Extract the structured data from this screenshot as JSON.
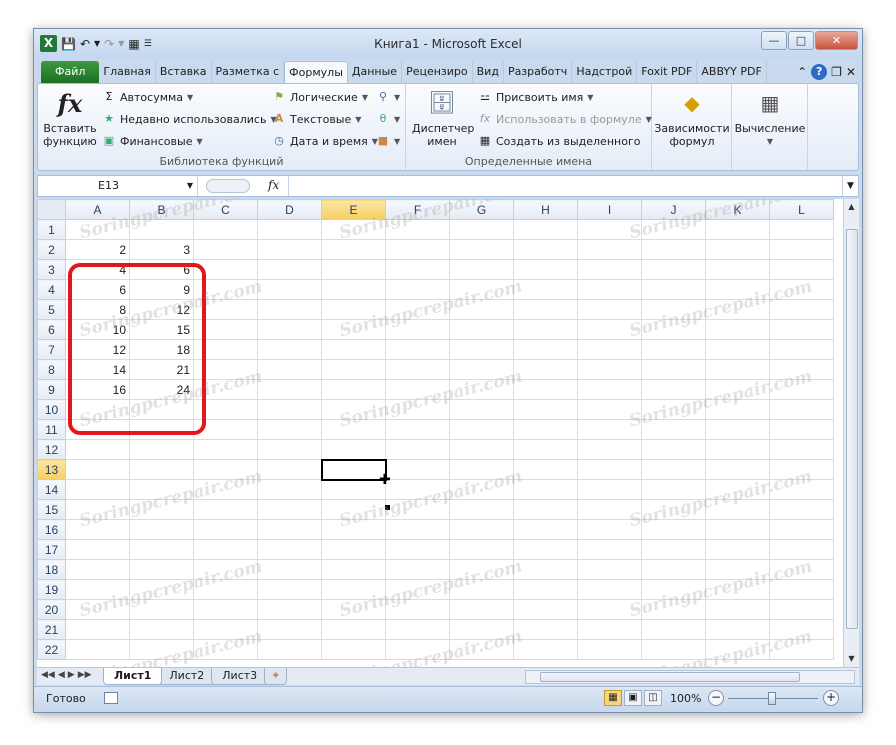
{
  "window": {
    "title": "Книга1  -  Microsoft Excel"
  },
  "tabs": [
    "Файл",
    "Главная",
    "Вставка",
    "Разметка с",
    "Формулы",
    "Данные",
    "Рецензиро",
    "Вид",
    "Разработч",
    "Надстрой",
    "Foxit PDF",
    "ABBYY PDF"
  ],
  "active_tab": "Формулы",
  "ribbon": {
    "insert_function": "Вставить\nфункцию",
    "lib_items": [
      {
        "label": "Автосумма",
        "icon": "sigma-icon"
      },
      {
        "label": "Недавно использовались",
        "icon": "recent-icon"
      },
      {
        "label": "Финансовые",
        "icon": "finance-icon"
      },
      {
        "label": "Логические",
        "icon": "logic-icon"
      },
      {
        "label": "Текстовые",
        "icon": "text-icon"
      },
      {
        "label": "Дата и время",
        "icon": "date-icon"
      }
    ],
    "lib_group_label": "Библиотека функций",
    "name_manager": "Диспетчер\nимен",
    "assign_name": "Присвоить имя",
    "use_in_formula": "Использовать в формуле",
    "create_from_selection": "Создать из выделенного",
    "names_group_label": "Определенные имена",
    "dependencies": "Зависимости\nформул",
    "calculation": "Вычисление"
  },
  "formula_bar": {
    "name_box": "E13",
    "formula": ""
  },
  "grid": {
    "columns": [
      "A",
      "B",
      "C",
      "D",
      "E",
      "F",
      "G",
      "H",
      "I",
      "J",
      "K",
      "L"
    ],
    "selected_column": "E",
    "selected_row": 13,
    "rows": [
      [
        "",
        ""
      ],
      [
        "2",
        "3"
      ],
      [
        "4",
        "6"
      ],
      [
        "6",
        "9"
      ],
      [
        "8",
        "12"
      ],
      [
        "10",
        "15"
      ],
      [
        "12",
        "18"
      ],
      [
        "14",
        "21"
      ],
      [
        "16",
        "24"
      ],
      [
        "",
        ""
      ],
      [
        "",
        ""
      ],
      [
        "",
        ""
      ],
      [
        "",
        ""
      ],
      [
        "",
        ""
      ],
      [
        "",
        ""
      ],
      [
        "",
        ""
      ],
      [
        "",
        ""
      ],
      [
        "",
        ""
      ],
      [
        "",
        ""
      ],
      [
        "",
        ""
      ],
      [
        "",
        ""
      ],
      [
        "",
        ""
      ]
    ]
  },
  "sheets": [
    "Лист1",
    "Лист2",
    "Лист3"
  ],
  "active_sheet": "Лист1",
  "status": {
    "ready": "Готово",
    "zoom": "100%"
  },
  "watermark": "Soringpcrepair.com"
}
